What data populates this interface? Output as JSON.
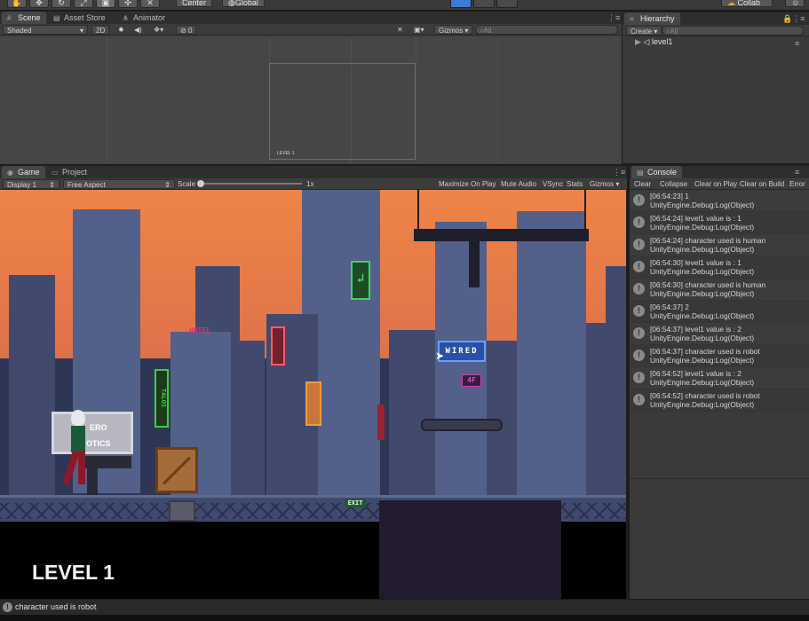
{
  "toolbar": {
    "pivot_center": "Center",
    "pivot_global": "Global",
    "collab": "Collab"
  },
  "scene_panel": {
    "tabs": [
      {
        "label": "Scene",
        "icon": "grid-icon"
      },
      {
        "label": "Asset Store",
        "icon": "store-icon"
      },
      {
        "label": "Animator",
        "icon": "animator-icon"
      }
    ],
    "shading_mode": "Shaded",
    "mode_2d": "2D",
    "hidden_count": "0",
    "gizmos": "Gizmos",
    "search_placeholder": "All",
    "camera_label": "LEVEL 1"
  },
  "hierarchy": {
    "title": "Hierarchy",
    "create": "Create",
    "search_placeholder": "All",
    "scene_root": "level1"
  },
  "game_panel": {
    "tabs": [
      {
        "label": "Game",
        "icon": "gamepad-icon"
      },
      {
        "label": "Project",
        "icon": "folder-icon"
      }
    ],
    "display": "Display 1",
    "aspect": "Free Aspect",
    "scale_label": "Scale",
    "scale_value": 0,
    "scale_readout": "1x",
    "maximize_on_play": "Maximize On Play",
    "mute_audio": "Mute Audio",
    "vsync": "VSync",
    "stats": "Stats",
    "gizmos": "Gizmos",
    "hud_level": "LEVEL 1",
    "signs": {
      "hotel": "HOTEL",
      "wired": "WIRED",
      "four_f": "4F",
      "exit": "EXIT",
      "billboard_line1": "ERO",
      "billboard_line2": "OTICS",
      "talos": "TALOS"
    }
  },
  "console": {
    "title": "Console",
    "buttons": [
      "Clear",
      "Collapse",
      "Clear on Play",
      "Clear on Build",
      "Error"
    ],
    "entries": [
      {
        "line1": "[06:54:23] 1",
        "line2": "UnityEngine.Debug:Log(Object)"
      },
      {
        "line1": "[06:54:24] level1 value is : 1",
        "line2": "UnityEngine.Debug:Log(Object)"
      },
      {
        "line1": "[06:54:24] character used is human",
        "line2": "UnityEngine.Debug:Log(Object)"
      },
      {
        "line1": "[06:54:30] level1 value is : 1",
        "line2": "UnityEngine.Debug:Log(Object)"
      },
      {
        "line1": "[06:54:30] character used is human",
        "line2": "UnityEngine.Debug:Log(Object)"
      },
      {
        "line1": "[06:54:37] 2",
        "line2": "UnityEngine.Debug:Log(Object)"
      },
      {
        "line1": "[06:54:37] level1 value is : 2",
        "line2": "UnityEngine.Debug:Log(Object)"
      },
      {
        "line1": "[06:54:37] character used is robot",
        "line2": "UnityEngine.Debug:Log(Object)"
      },
      {
        "line1": "[06:54:52] level1 value is : 2",
        "line2": "UnityEngine.Debug:Log(Object)"
      },
      {
        "line1": "[06:54:52] character used is robot",
        "line2": "UnityEngine.Debug:Log(Object)"
      }
    ]
  },
  "status_bar": {
    "message": "character used is robot"
  },
  "colors": {
    "panel_bg": "#424242",
    "sky": "#e07a48",
    "play_active": "#3d7bd8"
  }
}
